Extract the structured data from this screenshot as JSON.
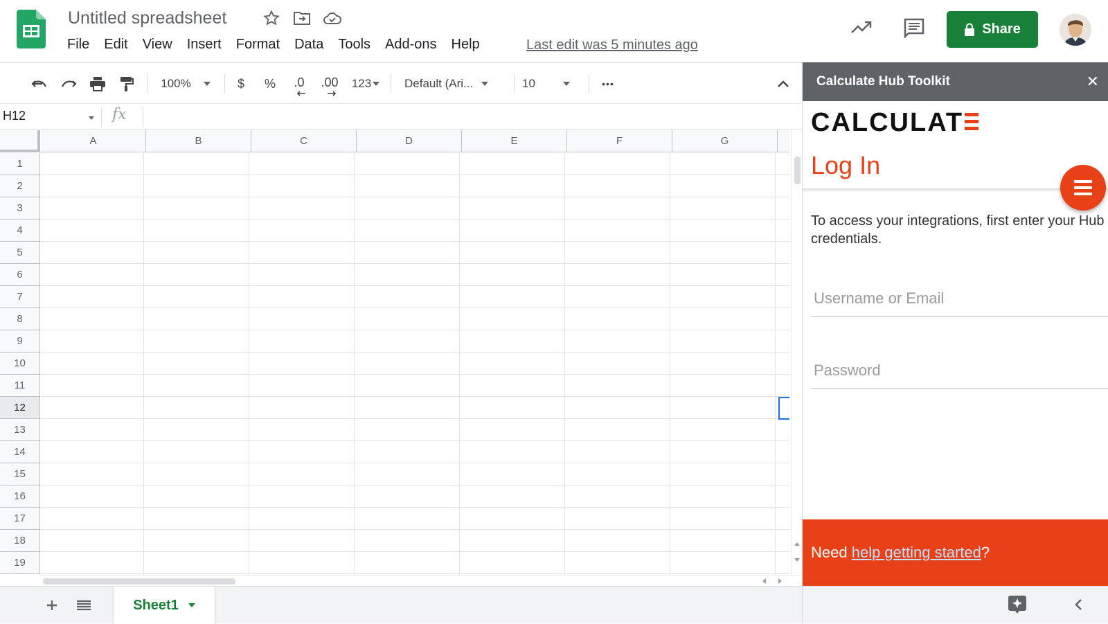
{
  "doc": {
    "title": "Untitled spreadsheet",
    "last_edit": "Last edit was 5 minutes ago",
    "share_label": "Share"
  },
  "menu": [
    "File",
    "Edit",
    "View",
    "Insert",
    "Format",
    "Data",
    "Tools",
    "Add-ons",
    "Help"
  ],
  "toolbar": {
    "zoom": "100%",
    "currency": "$",
    "percent": "%",
    "dec_decrease": ".0",
    "dec_increase": ".00",
    "number_format": "123",
    "font": "Default (Ari...",
    "font_size": "10",
    "more": "•••"
  },
  "formula_bar": {
    "name_box": "H12",
    "fx": "fx"
  },
  "grid": {
    "columns": [
      "A",
      "B",
      "C",
      "D",
      "E",
      "F",
      "G"
    ],
    "rows": [
      "1",
      "2",
      "3",
      "4",
      "5",
      "6",
      "7",
      "8",
      "9",
      "10",
      "11",
      "12",
      "13",
      "14",
      "15",
      "16",
      "17",
      "18",
      "19"
    ],
    "selected_row": "12"
  },
  "sheets": {
    "active": "Sheet1"
  },
  "panel": {
    "header": "Calculate Hub Toolkit",
    "close": "✕",
    "brand": "CALCULAT",
    "login_title": "Log In",
    "intro": "To access your integrations, first enter your Hub credentials.",
    "username_placeholder": "Username or Email",
    "password_placeholder": "Password",
    "help_prefix": "Need ",
    "help_link": "help getting started",
    "help_suffix": "?",
    "accent_color": "#e84118"
  },
  "colors": {
    "share_green": "#188038",
    "selection_blue": "#1a73e8"
  }
}
